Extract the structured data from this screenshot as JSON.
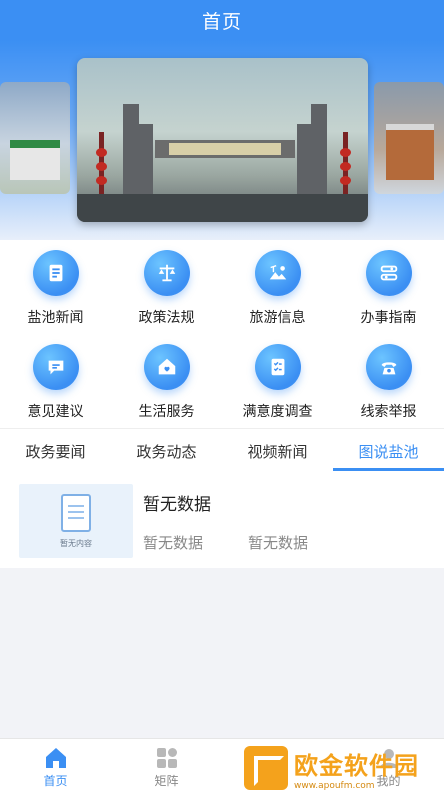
{
  "header": {
    "title": "首页"
  },
  "colors": {
    "accent": "#3b8ff3"
  },
  "banner": {
    "sign_text": "盐池高级中学"
  },
  "grid": [
    {
      "label": "盐池新闻",
      "icon": "news-icon"
    },
    {
      "label": "政策法规",
      "icon": "scale-icon"
    },
    {
      "label": "旅游信息",
      "icon": "travel-icon"
    },
    {
      "label": "办事指南",
      "icon": "guide-icon"
    },
    {
      "label": "意见建议",
      "icon": "message-icon"
    },
    {
      "label": "生活服务",
      "icon": "home-heart-icon"
    },
    {
      "label": "满意度调查",
      "icon": "checklist-icon"
    },
    {
      "label": "线索举报",
      "icon": "phone-icon"
    }
  ],
  "tabs": [
    {
      "label": "政务要闻"
    },
    {
      "label": "政务动态"
    },
    {
      "label": "视频新闻"
    },
    {
      "label": "图说盐池",
      "active": true
    }
  ],
  "news": {
    "title": "暂无数据",
    "meta1": "暂无数据",
    "meta2": "暂无数据",
    "thumb_text": "暂无内容"
  },
  "bottom_nav": [
    {
      "label": "首页",
      "icon": "home-icon",
      "active": true
    },
    {
      "label": "矩阵",
      "icon": "grid-icon"
    },
    {
      "label": "我的",
      "icon": "user-icon"
    }
  ],
  "watermark": {
    "main": "欧金软件园",
    "sub": "www.apoufm.com"
  }
}
